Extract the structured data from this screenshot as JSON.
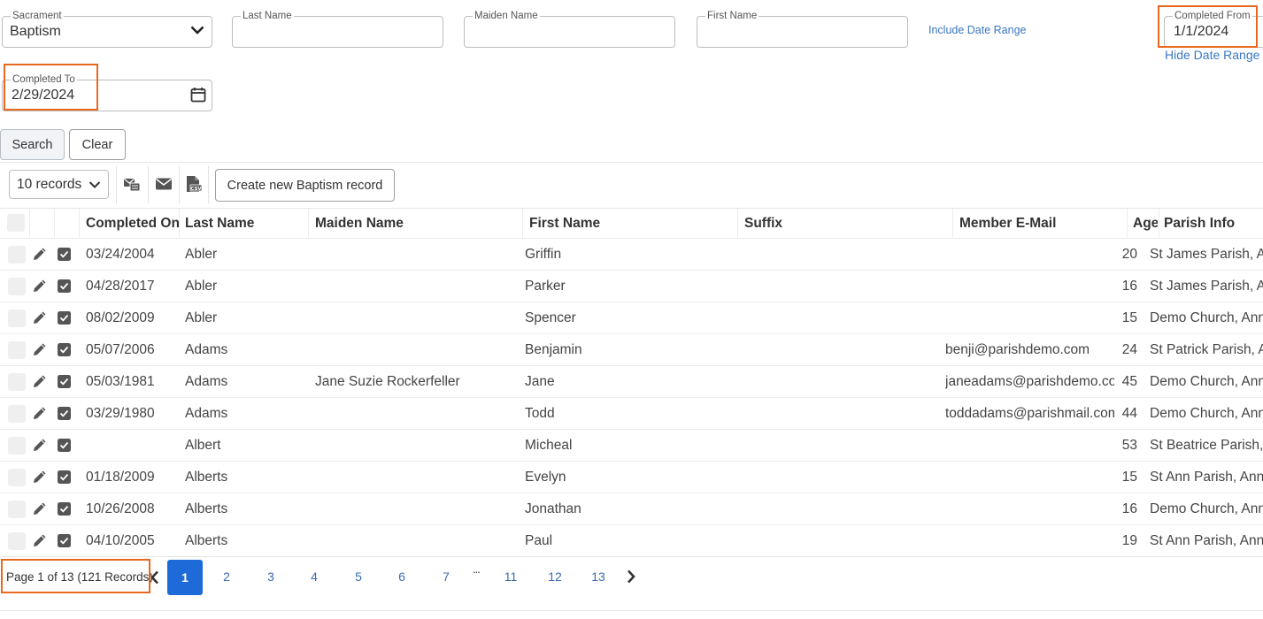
{
  "filters": {
    "sacrament": {
      "label": "Sacrament",
      "value": "Baptism"
    },
    "last_name": {
      "label": "Last Name",
      "value": ""
    },
    "maiden_name": {
      "label": "Maiden Name",
      "value": ""
    },
    "first_name": {
      "label": "First Name",
      "value": ""
    },
    "include_date_range": "Include Date Range",
    "completed_from": {
      "label": "Completed From",
      "value": "1/1/2024"
    },
    "hide_date_range": "Hide Date Range",
    "completed_to": {
      "label": "Completed To",
      "value": "2/29/2024"
    }
  },
  "actions": {
    "search": "Search",
    "clear": "Clear"
  },
  "toolbar": {
    "records_per_page": "10 records",
    "create_button": "Create new Baptism record",
    "icons": [
      "mail-bulk-icon",
      "envelope-icon",
      "csv-file-icon"
    ]
  },
  "table": {
    "columns": [
      "Completed On",
      "Last Name",
      "Maiden Name",
      "First Name",
      "Suffix",
      "Member E-Mail",
      "Age",
      "Parish Info"
    ],
    "rows": [
      {
        "completed": "03/24/2004",
        "last": "Abler",
        "maiden": "",
        "first": "Griffin",
        "suffix": "",
        "email": "",
        "age": "20",
        "parish": "St James Parish, A"
      },
      {
        "completed": "04/28/2017",
        "last": "Abler",
        "maiden": "",
        "first": "Parker",
        "suffix": "",
        "email": "",
        "age": "16",
        "parish": "St James Parish, A"
      },
      {
        "completed": "08/02/2009",
        "last": "Abler",
        "maiden": "",
        "first": "Spencer",
        "suffix": "",
        "email": "",
        "age": "15",
        "parish": "Demo Church, Ann"
      },
      {
        "completed": "05/07/2006",
        "last": "Adams",
        "maiden": "",
        "first": "Benjamin",
        "suffix": "",
        "email": "benji@parishdemo.com",
        "age": "24",
        "parish": "St Patrick Parish, A"
      },
      {
        "completed": "05/03/1981",
        "last": "Adams",
        "maiden": "Jane Suzie Rockerfeller",
        "first": "Jane",
        "suffix": "",
        "email": "janeadams@parishdemo.co",
        "age": "45",
        "parish": "Demo Church, Ann"
      },
      {
        "completed": "03/29/1980",
        "last": "Adams",
        "maiden": "",
        "first": "Todd",
        "suffix": "",
        "email": "toddadams@parishmail.com",
        "age": "44",
        "parish": "Demo Church, Ann"
      },
      {
        "completed": "",
        "last": "Albert",
        "maiden": "",
        "first": "Micheal",
        "suffix": "",
        "email": "",
        "age": "53",
        "parish": "St Beatrice Parish,"
      },
      {
        "completed": "01/18/2009",
        "last": "Alberts",
        "maiden": "",
        "first": "Evelyn",
        "suffix": "",
        "email": "",
        "age": "15",
        "parish": "St Ann Parish, Ann"
      },
      {
        "completed": "10/26/2008",
        "last": "Alberts",
        "maiden": "",
        "first": "Jonathan",
        "suffix": "",
        "email": "",
        "age": "16",
        "parish": "Demo Church, Ann"
      },
      {
        "completed": "04/10/2005",
        "last": "Alberts",
        "maiden": "",
        "first": "Paul",
        "suffix": "",
        "email": "",
        "age": "19",
        "parish": "St Ann Parish, Ann"
      }
    ]
  },
  "pagination": {
    "summary": "Page 1 of 13 (121 Records)",
    "current": "1",
    "pages": [
      "2",
      "3",
      "4",
      "5",
      "6",
      "7",
      "11",
      "12",
      "13"
    ],
    "ellipsis": "..."
  },
  "colors": {
    "accent": "#1e6ad8",
    "highlight": "#e8691e",
    "link": "#3a77c2"
  }
}
